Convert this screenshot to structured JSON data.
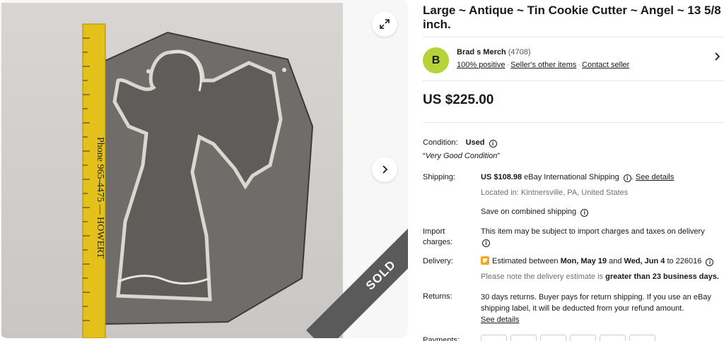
{
  "gallery": {
    "ruler_text": "Phone 965-4475 — HOWERT",
    "sold_label": "SOLD"
  },
  "listing": {
    "title": "Large ~ Antique ~ Tin Cookie Cutter ~ Angel ~ 13 5/8 inch.",
    "price": "US $225.00"
  },
  "seller": {
    "avatar_letter": "B",
    "name": "Brad s Merch",
    "feedback_count": "(4708)",
    "positive": "100% positive",
    "other_items": "Seller's other items",
    "contact": "Contact seller"
  },
  "condition": {
    "label": "Condition:",
    "value": "Used",
    "note_open": "“",
    "note": "Very Good Condition",
    "note_close": "”"
  },
  "shipping": {
    "label": "Shipping:",
    "amount": "US $108.98",
    "method": "eBay International Shipping",
    "see_details": "See details",
    "location": "Located in: Kintnersville, PA, United States",
    "combined": "Save on combined shipping"
  },
  "import": {
    "label": "Import charges:",
    "text": "This item may be subject to import charges and taxes on delivery"
  },
  "delivery": {
    "label": "Delivery:",
    "est_prefix": "Estimated between",
    "date1": "Mon, May 19",
    "and": "and",
    "date2": "Wed, Jun 4",
    "to": "to 226016",
    "note_prefix": "Please note the delivery estimate is",
    "note_bold": "greater than 23 business days."
  },
  "returns": {
    "label": "Returns:",
    "text": "30 days returns. Buyer pays for return shipping. If you use an eBay shipping label, it will be deducted from your refund amount.",
    "see_details": "See details"
  },
  "payments": {
    "label": "Payments:"
  }
}
